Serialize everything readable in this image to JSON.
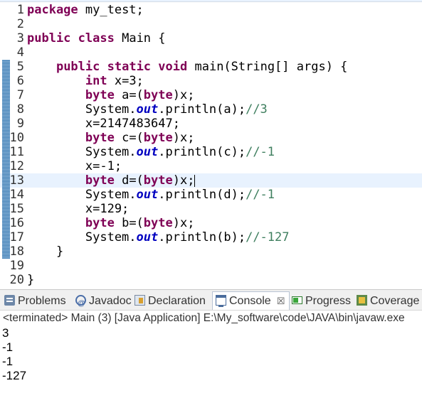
{
  "editor": {
    "lines": [
      {
        "num": "1",
        "tokens": [
          {
            "t": "package",
            "c": "kw"
          },
          {
            "t": " my_test;",
            "c": "pln"
          }
        ]
      },
      {
        "num": "2",
        "tokens": []
      },
      {
        "num": "3",
        "tokens": [
          {
            "t": "public",
            "c": "kw"
          },
          {
            "t": " ",
            "c": "pln"
          },
          {
            "t": "class",
            "c": "kw"
          },
          {
            "t": " Main {",
            "c": "pln"
          }
        ]
      },
      {
        "num": "4",
        "tokens": []
      },
      {
        "num": "5",
        "changed": true,
        "tokens": [
          {
            "t": "    ",
            "c": "pln"
          },
          {
            "t": "public",
            "c": "kw"
          },
          {
            "t": " ",
            "c": "pln"
          },
          {
            "t": "static",
            "c": "kw"
          },
          {
            "t": " ",
            "c": "pln"
          },
          {
            "t": "void",
            "c": "kw"
          },
          {
            "t": " main(String[] args) {",
            "c": "pln"
          }
        ]
      },
      {
        "num": "6",
        "changed": true,
        "tokens": [
          {
            "t": "        ",
            "c": "pln"
          },
          {
            "t": "int",
            "c": "kw"
          },
          {
            "t": " x=3;",
            "c": "pln"
          }
        ]
      },
      {
        "num": "7",
        "changed": true,
        "tokens": [
          {
            "t": "        ",
            "c": "pln"
          },
          {
            "t": "byte",
            "c": "kw"
          },
          {
            "t": " a=(",
            "c": "pln"
          },
          {
            "t": "byte",
            "c": "kw"
          },
          {
            "t": ")x;",
            "c": "pln"
          }
        ]
      },
      {
        "num": "8",
        "changed": true,
        "tokens": [
          {
            "t": "        System.",
            "c": "pln"
          },
          {
            "t": "out",
            "c": "fld"
          },
          {
            "t": ".println(a);",
            "c": "pln"
          },
          {
            "t": "//3",
            "c": "cmt"
          }
        ]
      },
      {
        "num": "9",
        "changed": true,
        "tokens": [
          {
            "t": "        x=2147483647;",
            "c": "pln"
          }
        ]
      },
      {
        "num": "10",
        "changed": true,
        "tokens": [
          {
            "t": "        ",
            "c": "pln"
          },
          {
            "t": "byte",
            "c": "kw"
          },
          {
            "t": " c=(",
            "c": "pln"
          },
          {
            "t": "byte",
            "c": "kw"
          },
          {
            "t": ")x;",
            "c": "pln"
          }
        ]
      },
      {
        "num": "11",
        "changed": true,
        "tokens": [
          {
            "t": "        System.",
            "c": "pln"
          },
          {
            "t": "out",
            "c": "fld"
          },
          {
            "t": ".println(c);",
            "c": "pln"
          },
          {
            "t": "//-1",
            "c": "cmt"
          }
        ]
      },
      {
        "num": "12",
        "changed": true,
        "tokens": [
          {
            "t": "        x=-1;",
            "c": "pln"
          }
        ]
      },
      {
        "num": "13",
        "changed": true,
        "current": true,
        "caret": true,
        "tokens": [
          {
            "t": "        ",
            "c": "pln"
          },
          {
            "t": "byte",
            "c": "kw"
          },
          {
            "t": " d=(",
            "c": "pln"
          },
          {
            "t": "byte",
            "c": "kw"
          },
          {
            "t": ")x;",
            "c": "pln"
          }
        ]
      },
      {
        "num": "14",
        "changed": true,
        "tokens": [
          {
            "t": "        System.",
            "c": "pln"
          },
          {
            "t": "out",
            "c": "fld"
          },
          {
            "t": ".println(d);",
            "c": "pln"
          },
          {
            "t": "//-1",
            "c": "cmt"
          }
        ]
      },
      {
        "num": "15",
        "changed": true,
        "tokens": [
          {
            "t": "        x=129;",
            "c": "pln"
          }
        ]
      },
      {
        "num": "16",
        "changed": true,
        "tokens": [
          {
            "t": "        ",
            "c": "pln"
          },
          {
            "t": "byte",
            "c": "kw"
          },
          {
            "t": " b=(",
            "c": "pln"
          },
          {
            "t": "byte",
            "c": "kw"
          },
          {
            "t": ")x;",
            "c": "pln"
          }
        ]
      },
      {
        "num": "17",
        "changed": true,
        "tokens": [
          {
            "t": "        System.",
            "c": "pln"
          },
          {
            "t": "out",
            "c": "fld"
          },
          {
            "t": ".println(b);",
            "c": "pln"
          },
          {
            "t": "//-127",
            "c": "cmt"
          }
        ]
      },
      {
        "num": "18",
        "changed": true,
        "tokens": [
          {
            "t": "    }",
            "c": "pln"
          }
        ]
      },
      {
        "num": "19",
        "tokens": []
      },
      {
        "num": "20",
        "tokens": [
          {
            "t": "}",
            "c": "pln"
          }
        ]
      }
    ]
  },
  "tabs": [
    {
      "label": "Problems",
      "icon": "problems-icon",
      "name": "tab-problems"
    },
    {
      "label": "Javadoc",
      "icon": "javadoc-icon",
      "name": "tab-javadoc"
    },
    {
      "label": "Declaration",
      "icon": "declaration-icon",
      "name": "tab-declaration"
    },
    {
      "label": "Console",
      "icon": "console-icon",
      "name": "tab-console",
      "active": true,
      "close": "☒"
    },
    {
      "label": "Progress",
      "icon": "progress-icon",
      "name": "tab-progress"
    },
    {
      "label": "Coverage",
      "icon": "coverage-icon",
      "name": "tab-coverage"
    }
  ],
  "console": {
    "status": "<terminated> Main (3) [Java Application] E:\\My_software\\code\\JAVA\\bin\\javaw.exe",
    "output": [
      "3",
      "-1",
      "-1",
      "-127"
    ]
  },
  "colors": {
    "keyword": "#7f0055",
    "static_field": "#0000c0",
    "comment": "#3f7f5f",
    "current_line": "#e8f2fe"
  }
}
